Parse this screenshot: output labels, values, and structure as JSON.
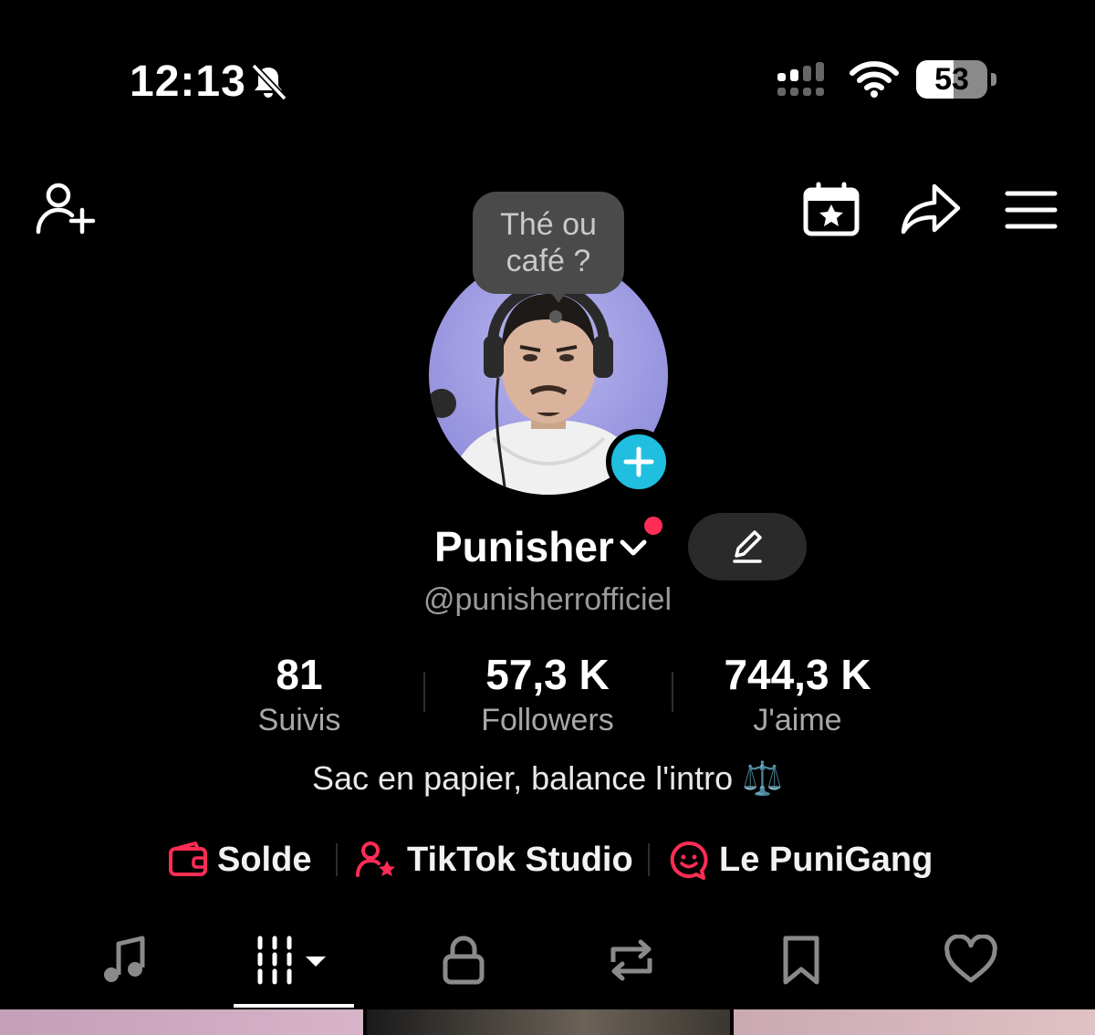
{
  "status_bar": {
    "time": "12:13",
    "battery_level": "53",
    "battery_fraction": 0.53,
    "icons": [
      "bell-slash-icon",
      "cellular-signal-icon",
      "wifi-icon",
      "battery-icon"
    ]
  },
  "header": {
    "icons": [
      "add-friend-icon",
      "calendar-star-icon",
      "share-icon",
      "hamburger-menu-icon"
    ]
  },
  "note": {
    "line1": "Thé ou",
    "line2": "café ?"
  },
  "profile": {
    "display_name": "Punisher",
    "handle": "@punisherrofficiel",
    "bio": "Sac en papier, balance l'intro ⚖️"
  },
  "stats": {
    "following": {
      "value": "81",
      "label": "Suivis"
    },
    "followers": {
      "value": "57,3 K",
      "label": "Followers"
    },
    "likes": {
      "value": "744,3 K",
      "label": "J'aime"
    }
  },
  "links": {
    "solde": "Solde",
    "studio": "TikTok Studio",
    "gang": "Le PuniGang"
  },
  "tabs": [
    "music-tab",
    "videos-tab",
    "private-tab",
    "reposts-tab",
    "saved-tab",
    "liked-tab"
  ],
  "colors": {
    "accent_red": "#ff2d55",
    "avatar_add": "#20bfe0",
    "background": "#000000"
  }
}
